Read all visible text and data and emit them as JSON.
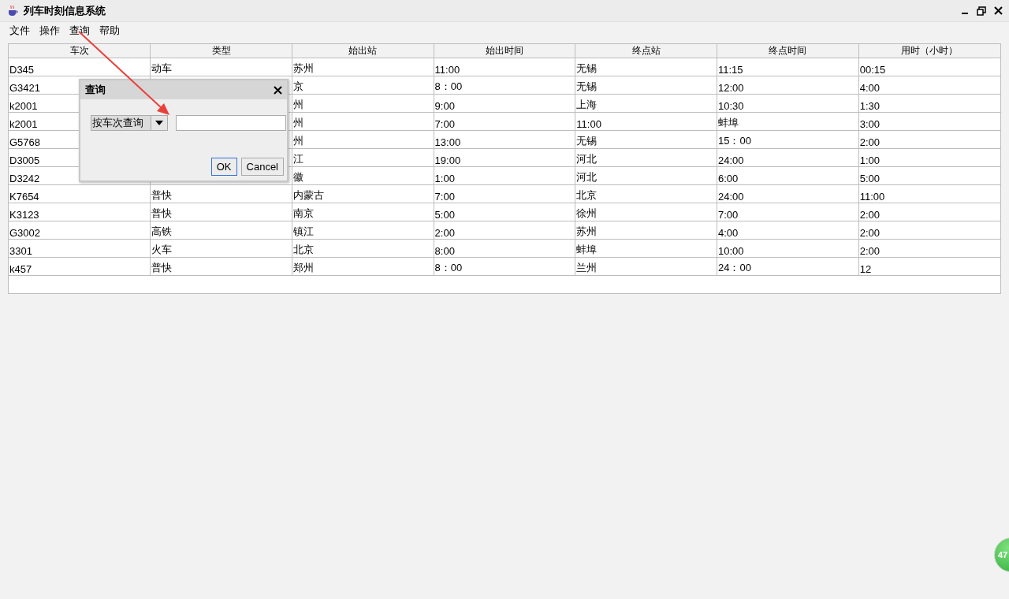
{
  "window": {
    "title": "列车时刻信息系统"
  },
  "menu": [
    "文件",
    "操作",
    "查询",
    "帮助"
  ],
  "table": {
    "columns": [
      "车次",
      "类型",
      "始出站",
      "始出时间",
      "终点站",
      "终点时间",
      "用时（小时）"
    ],
    "rows": [
      [
        "D345",
        "动车",
        "苏州",
        "11:00",
        "无锡",
        "11:15",
        "00:15"
      ],
      [
        "G3421",
        null,
        "京",
        "8：00",
        "无锡",
        "12:00",
        "4:00"
      ],
      [
        "k2001",
        null,
        "州",
        "9:00",
        "上海",
        "10:30",
        "1:30"
      ],
      [
        "k2001",
        null,
        "州",
        "7:00",
        "11:00",
        "蚌埠",
        "3:00"
      ],
      [
        "G5768",
        null,
        "州",
        "13:00",
        "无锡",
        "15：00",
        "2:00"
      ],
      [
        "D3005",
        null,
        "江",
        "19:00",
        "河北",
        "24:00",
        "1:00"
      ],
      [
        "D3242",
        null,
        "徽",
        "1:00",
        "河北",
        "6:00",
        "5:00"
      ],
      [
        "K7654",
        "普快",
        "内蒙古",
        "7:00",
        "北京",
        "24:00",
        "11:00"
      ],
      [
        "K3123",
        "普快",
        "南京",
        "5:00",
        "徐州",
        "7:00",
        "2:00"
      ],
      [
        "G3002",
        "高铁",
        "镇江",
        "2:00",
        "苏州",
        "4:00",
        "2:00"
      ],
      [
        "3301",
        "火车",
        "北京",
        "8:00",
        "蚌埠",
        "10:00",
        "2:00"
      ],
      [
        "k457",
        "普快",
        "郑州",
        "8：00",
        "兰州",
        "24：00",
        "12"
      ]
    ]
  },
  "dialog": {
    "title": "查询",
    "search_type": "按车次查询",
    "buttons": [
      {
        "label": "OK",
        "focused": true
      },
      {
        "label": "Cancel",
        "focused": false
      }
    ]
  },
  "badge": {
    "count": "47"
  }
}
